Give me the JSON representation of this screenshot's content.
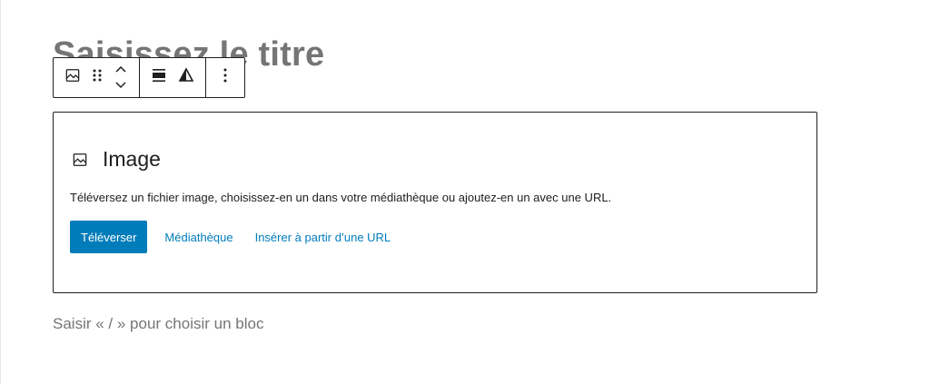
{
  "editor": {
    "title_placeholder": "Saisissez le titre",
    "appender_placeholder": "Saisir « / » pour choisir un bloc"
  },
  "toolbar": {
    "groups": [
      {
        "items": [
          {
            "icon": "image-icon"
          },
          {
            "icon": "drag-handle-icon"
          },
          {
            "icon": "move-up-icon"
          },
          {
            "icon": "move-down-icon"
          }
        ]
      },
      {
        "items": [
          {
            "icon": "align-wide-icon"
          },
          {
            "icon": "contrast-icon"
          }
        ]
      },
      {
        "items": [
          {
            "icon": "more-options-icon"
          }
        ]
      }
    ]
  },
  "image_block": {
    "icon": "image-icon",
    "label": "Image",
    "instructions": "Téléversez un fichier image, choisissez-en un dans votre médiathèque ou ajoutez-en un avec une URL.",
    "upload_label": "Téléverser",
    "media_library_label": "Médiathèque",
    "insert_url_label": "Insérer à partir d’une URL"
  },
  "colors": {
    "accent": "#007cba",
    "text": "#1e1e1e",
    "muted": "#757575",
    "border": "#1e1e1e"
  }
}
